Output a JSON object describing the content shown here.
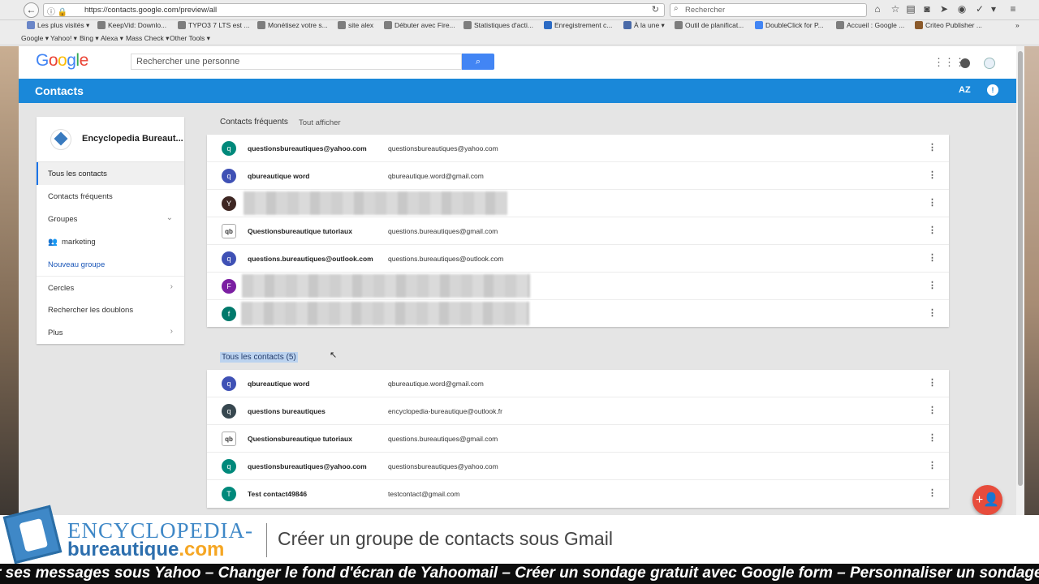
{
  "browser": {
    "url": "https://contacts.google.com/preview/all",
    "search_placeholder": "Rechercher",
    "bookmarks": [
      {
        "label": "Les plus visités ▾",
        "color": "#6a86c8"
      },
      {
        "label": "KeepVid: Downlo...",
        "color": "#7d7d7d"
      },
      {
        "label": "TYPO3 7 LTS est ...",
        "color": "#7d7d7d"
      },
      {
        "label": "Monétisez votre s...",
        "color": "#7d7d7d"
      },
      {
        "label": "site alex",
        "color": "#7d7d7d"
      },
      {
        "label": "Débuter avec Fire...",
        "color": "#7d7d7d"
      },
      {
        "label": "Statistiques d'acti...",
        "color": "#7d7d7d"
      },
      {
        "label": "Enregistrement c...",
        "color": "#2c6bc4"
      },
      {
        "label": "À la une ▾",
        "color": "#4a6aa8"
      },
      {
        "label": "Outil de planificat...",
        "color": "#7d7d7d"
      },
      {
        "label": "DoubleClick for P...",
        "color": "#4285f4"
      },
      {
        "label": "Accueil : Google ...",
        "color": "#7d7d7d"
      },
      {
        "label": "Criteo Publisher ...",
        "color": "#8b5a2b"
      }
    ],
    "menus": [
      "Google ▾",
      "Yahoo! ▾",
      "Bing ▾",
      "Alexa ▾",
      "Mass Check ▾",
      "Other Tools ▾"
    ]
  },
  "header": {
    "logo": "Google",
    "search_placeholder": "Rechercher une personne"
  },
  "bluebar": {
    "title": "Contacts",
    "sort_label": "AZ"
  },
  "sidebar": {
    "account_name": "Encyclopedia Bureaut...",
    "items": [
      {
        "label": "Tous les contacts"
      },
      {
        "label": "Contacts fréquents"
      },
      {
        "label": "Groupes"
      },
      {
        "label": "marketing"
      },
      {
        "label": "Nouveau groupe"
      },
      {
        "label": "Cercles"
      },
      {
        "label": "Rechercher les doublons"
      },
      {
        "label": "Plus"
      }
    ]
  },
  "frequent": {
    "title": "Contacts fréquents",
    "link": "Tout afficher",
    "rows": [
      {
        "initial": "q",
        "color": "#00897b",
        "name": "questionsbureautiques@yahoo.com",
        "email": "questionsbureautiques@yahoo.com"
      },
      {
        "initial": "q",
        "color": "#3f51b5",
        "name": "qbureautique word",
        "email": "qbureautique.word@gmail.com"
      },
      {
        "initial": "Y",
        "color": "#3e2723",
        "name": "",
        "email": ""
      },
      {
        "initial": "qb",
        "color": "#ffffff",
        "name": "Questionsbureautique tutoriaux",
        "email": "questions.bureautiques@gmail.com"
      },
      {
        "initial": "q",
        "color": "#3f51b5",
        "name": "questions.bureautiques@outlook.com",
        "email": "questions.bureautiques@outlook.com"
      },
      {
        "initial": "F",
        "color": "#7b1fa2",
        "name": "",
        "email": ""
      },
      {
        "initial": "f",
        "color": "#00796b",
        "name": "",
        "email": ""
      }
    ]
  },
  "all": {
    "title": "Tous les contacts (5)",
    "rows": [
      {
        "initial": "q",
        "color": "#3f51b5",
        "name": "qbureautique word",
        "email": "qbureautique.word@gmail.com"
      },
      {
        "initial": "q",
        "color": "#37474f",
        "name": "questions bureautiques",
        "email": "encyclopedia-bureautique@outlook.fr"
      },
      {
        "initial": "qb",
        "color": "#ffffff",
        "name": "Questionsbureautique tutoriaux",
        "email": "questions.bureautiques@gmail.com"
      },
      {
        "initial": "q",
        "color": "#00897b",
        "name": "questionsbureautiques@yahoo.com",
        "email": "questionsbureautiques@yahoo.com"
      },
      {
        "initial": "T",
        "color": "#00897b",
        "name": "Test contact49846",
        "email": "testcontact@gmail.com"
      }
    ]
  },
  "banner": {
    "brand_line1": "ENCYCLOPEDIA-",
    "brand_line2": "bureautique",
    "brand_tld": ".com",
    "title": "Créer un groupe de contacts sous Gmail",
    "ticker": "r ses messages sous Yahoo – Changer le fond d'écran de Yahoomail – Créer un sondage gratuit avec Google form – Personnaliser un sondage G"
  },
  "colors": {
    "accent": "#1a88d9",
    "fab": "#e74c3c",
    "brand_blue": "#3f88c7"
  }
}
